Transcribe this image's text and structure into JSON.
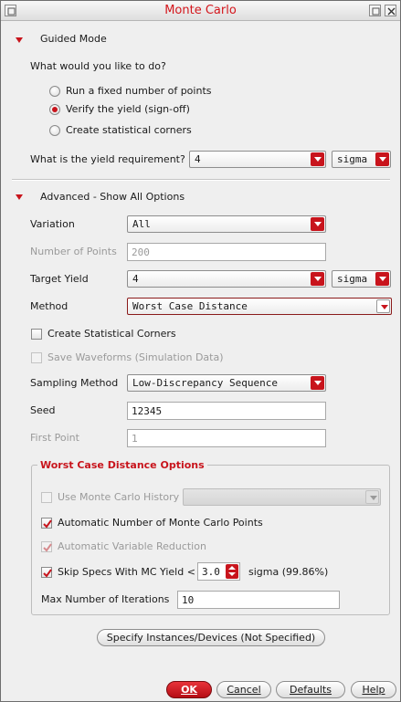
{
  "window": {
    "title": "Monte Carlo"
  },
  "guided": {
    "header": "Guided Mode",
    "question": "What would you like to do?",
    "options": [
      {
        "label": "Run a fixed number of points",
        "selected": false
      },
      {
        "label": "Verify the yield (sign-off)",
        "selected": true
      },
      {
        "label": "Create statistical corners",
        "selected": false
      }
    ],
    "yield_label": "What is the yield requirement?",
    "yield_value": "4",
    "yield_unit": "sigma"
  },
  "advanced": {
    "header": "Advanced - Show All Options",
    "variation": {
      "label": "Variation",
      "value": "All"
    },
    "num_points": {
      "label": "Number of Points",
      "value": "200"
    },
    "target_yield": {
      "label": "Target Yield",
      "value": "4",
      "unit": "sigma"
    },
    "method": {
      "label": "Method",
      "value": "Worst Case Distance"
    },
    "create_corners": {
      "label": "Create Statistical Corners",
      "checked": false
    },
    "save_waveforms": {
      "label": "Save Waveforms (Simulation Data)",
      "checked": false
    },
    "sampling": {
      "label": "Sampling Method",
      "value": "Low-Discrepancy Sequence"
    },
    "seed": {
      "label": "Seed",
      "value": "12345"
    },
    "first_point": {
      "label": "First Point",
      "value": "1"
    }
  },
  "wcd": {
    "title": "Worst Case Distance Options",
    "mc_history": {
      "label": "Use Monte Carlo History",
      "checked": false,
      "value": ""
    },
    "auto_points": {
      "label": "Automatic Number of Monte Carlo Points",
      "checked": true
    },
    "auto_reduction": {
      "label": "Automatic Variable Reduction",
      "checked": true
    },
    "skip_specs": {
      "label": "Skip Specs With MC Yield <",
      "checked": true,
      "value": "3.0",
      "suffix": "sigma (99.86%)"
    },
    "max_iter": {
      "label": "Max Number of Iterations",
      "value": "10"
    }
  },
  "specify_button": "Specify Instances/Devices (Not Specified)",
  "buttons": {
    "ok": "OK",
    "cancel": "Cancel",
    "defaults": "Defaults",
    "help": "Help"
  },
  "colors": {
    "accent": "#c8141c",
    "background": "#efefef",
    "disabled_text": "#9a9a9a"
  }
}
